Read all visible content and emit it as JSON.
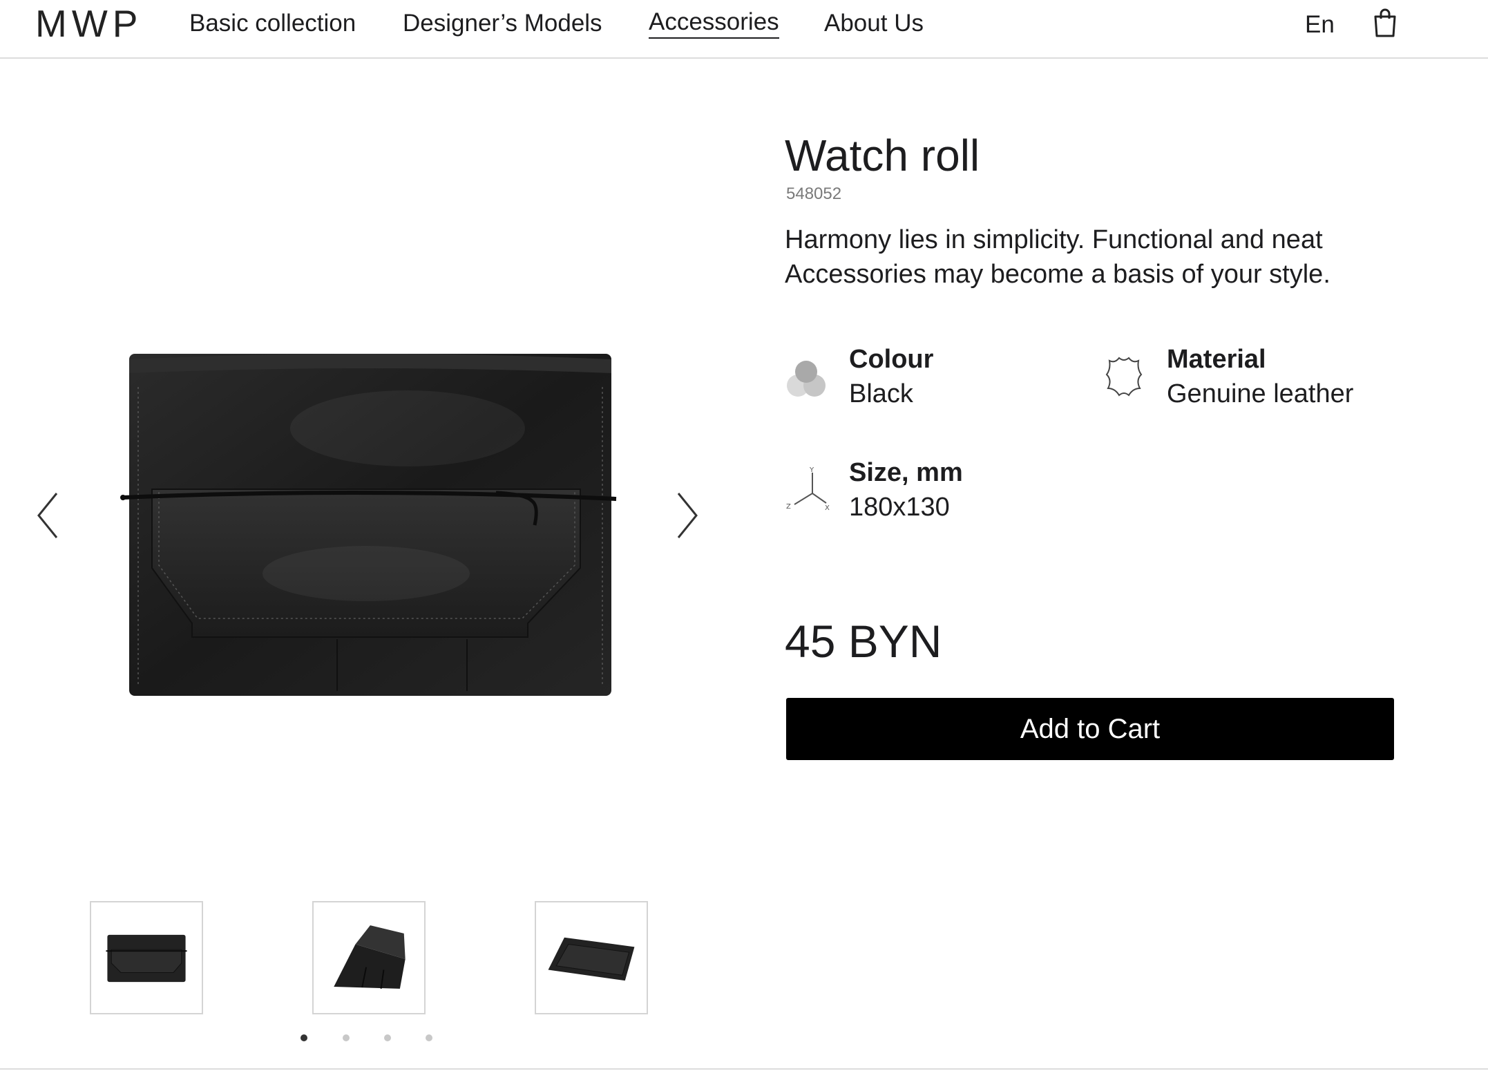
{
  "header": {
    "logo": "MWP",
    "nav": [
      {
        "label": "Basic collection"
      },
      {
        "label": "Designer’s Models"
      },
      {
        "label": "Accessories",
        "active": true
      },
      {
        "label": "About Us"
      }
    ],
    "language": "En",
    "cart_icon": "shopping-bag-icon"
  },
  "gallery": {
    "prev_icon": "chevron-left-icon",
    "next_icon": "chevron-right-icon",
    "thumbnail_count": 3,
    "dots": 4,
    "active_dot": 1
  },
  "product": {
    "title": "Watch roll",
    "sku": "548052",
    "description": "Harmony lies in simplicity. Functional and neat Accessories may become a basis of your style.",
    "attributes": {
      "colour": {
        "label": "Colour",
        "value": "Black",
        "icon": "colour-swatch-icon"
      },
      "material": {
        "label": "Material",
        "value": "Genuine leather",
        "icon": "leather-hide-icon"
      },
      "size": {
        "label": "Size, mm",
        "value": "180x130",
        "icon": "xyz-axes-icon"
      }
    },
    "price": "45 BYN",
    "add_to_cart_label": "Add to Cart"
  },
  "colors": {
    "primary_button": "#000000",
    "text": "#1d1d1f",
    "muted": "#7a7a7a",
    "border": "#dcdcdc"
  }
}
